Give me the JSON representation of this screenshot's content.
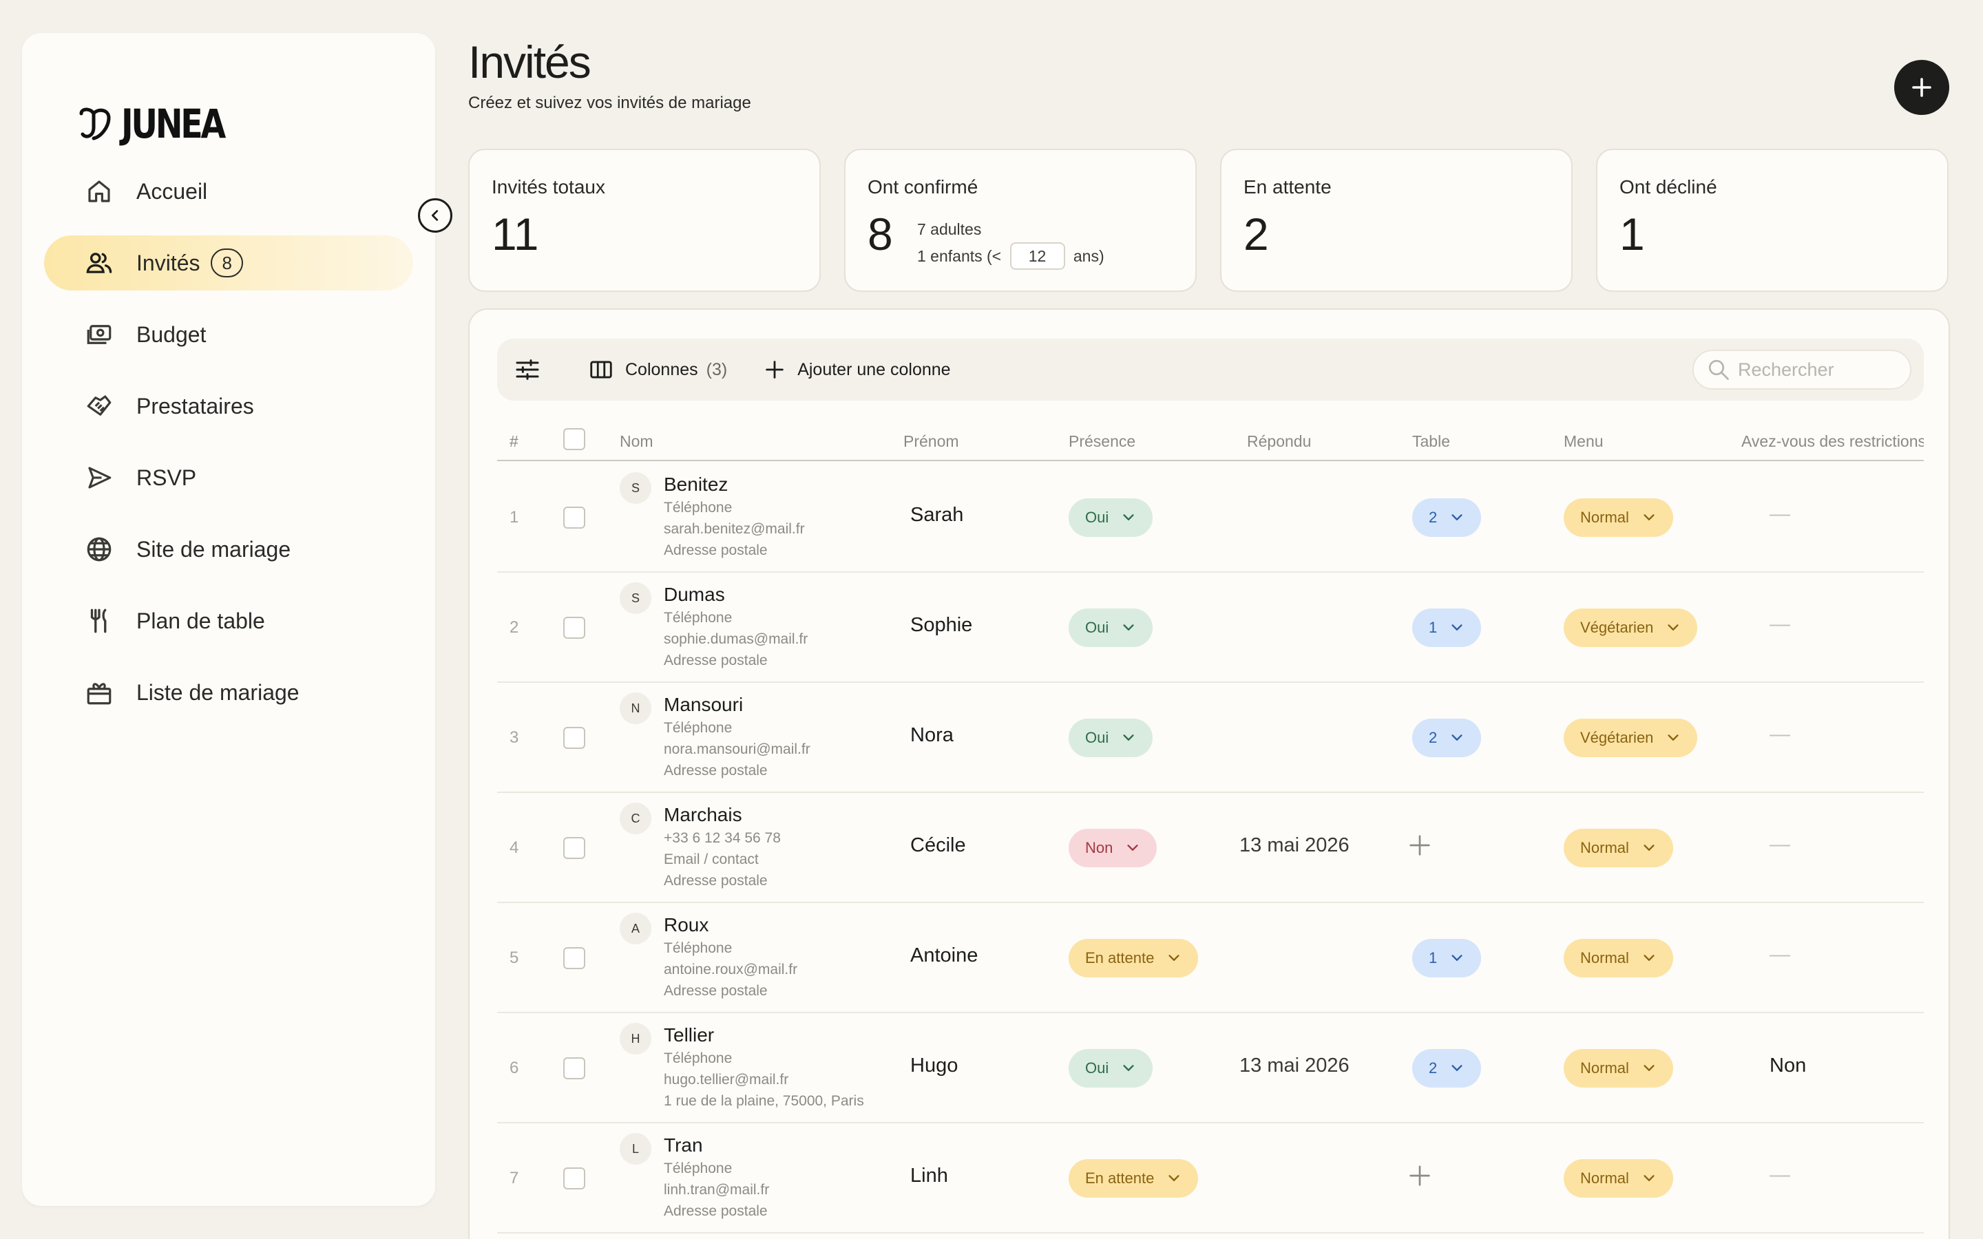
{
  "brand": {
    "name": "JUNEA"
  },
  "sidebar": {
    "items": [
      {
        "label": "Accueil",
        "icon": "home-icon"
      },
      {
        "label": "Invités",
        "icon": "users-icon",
        "badge": "8",
        "active": true
      },
      {
        "label": "Budget",
        "icon": "money-icon"
      },
      {
        "label": "Prestataires",
        "icon": "handshake-icon"
      },
      {
        "label": "RSVP",
        "icon": "send-icon"
      },
      {
        "label": "Site de mariage",
        "icon": "globe-icon"
      },
      {
        "label": "Plan de table",
        "icon": "cutlery-icon"
      },
      {
        "label": "Liste de mariage",
        "icon": "gift-icon"
      }
    ]
  },
  "header": {
    "title": "Invités",
    "subtitle": "Créez et suivez vos invités de mariage"
  },
  "stats": {
    "total": {
      "label": "Invités totaux",
      "value": "11"
    },
    "confirmed": {
      "label": "Ont confirmé",
      "value": "8",
      "adults": "7 adultes",
      "children_prefix": "1 enfants (<",
      "age_limit": "12",
      "children_suffix": "ans)"
    },
    "pending": {
      "label": "En attente",
      "value": "2"
    },
    "declined": {
      "label": "Ont décliné",
      "value": "1"
    }
  },
  "toolbar": {
    "columns_label": "Colonnes",
    "columns_count": "(3)",
    "add_column_label": "Ajouter une colonne",
    "search_placeholder": "Rechercher"
  },
  "table": {
    "headers": {
      "num": "#",
      "nom": "Nom",
      "prenom": "Prénom",
      "presence": "Présence",
      "repondu": "Répondu",
      "table": "Table",
      "menu": "Menu",
      "restrictions": "Avez-vous des restrictions"
    },
    "rows": [
      {
        "num": "1",
        "initial": "S",
        "nom": "Benitez",
        "l1": "Téléphone",
        "l2": "sarah.benitez@mail.fr",
        "l3": "Adresse postale",
        "prenom": "Sarah",
        "presence": "Oui",
        "presence_type": "oui",
        "repondu": "",
        "table": "2",
        "menu": "Normal",
        "restriction": "—"
      },
      {
        "num": "2",
        "initial": "S",
        "nom": "Dumas",
        "l1": "Téléphone",
        "l2": "sophie.dumas@mail.fr",
        "l3": "Adresse postale",
        "prenom": "Sophie",
        "presence": "Oui",
        "presence_type": "oui",
        "repondu": "",
        "table": "1",
        "menu": "Végétarien",
        "restriction": "—"
      },
      {
        "num": "3",
        "initial": "N",
        "nom": "Mansouri",
        "l1": "Téléphone",
        "l2": "nora.mansouri@mail.fr",
        "l3": "Adresse postale",
        "prenom": "Nora",
        "presence": "Oui",
        "presence_type": "oui",
        "repondu": "",
        "table": "2",
        "menu": "Végétarien",
        "restriction": "—"
      },
      {
        "num": "4",
        "initial": "C",
        "nom": "Marchais",
        "l1": "+33 6 12 34 56 78",
        "l2": "Email / contact",
        "l3": "Adresse postale",
        "prenom": "Cécile",
        "presence": "Non",
        "presence_type": "non",
        "repondu": "13 mai 2026",
        "table": "",
        "menu": "Normal",
        "restriction": "—"
      },
      {
        "num": "5",
        "initial": "A",
        "nom": "Roux",
        "l1": "Téléphone",
        "l2": "antoine.roux@mail.fr",
        "l3": "Adresse postale",
        "prenom": "Antoine",
        "presence": "En attente",
        "presence_type": "att",
        "repondu": "",
        "table": "1",
        "menu": "Normal",
        "restriction": "—"
      },
      {
        "num": "6",
        "initial": "H",
        "nom": "Tellier",
        "l1": "Téléphone",
        "l2": "hugo.tellier@mail.fr",
        "l3": "1 rue de la plaine, 75000, Paris",
        "prenom": "Hugo",
        "presence": "Oui",
        "presence_type": "oui",
        "repondu": "13 mai 2026",
        "table": "2",
        "menu": "Normal",
        "restriction": "Non"
      },
      {
        "num": "7",
        "initial": "L",
        "nom": "Tran",
        "l1": "Téléphone",
        "l2": "linh.tran@mail.fr",
        "l3": "Adresse postale",
        "prenom": "Linh",
        "presence": "En attente",
        "presence_type": "att",
        "repondu": "",
        "table": "",
        "menu": "Normal",
        "restriction": "—"
      }
    ]
  },
  "colors": {
    "background": "#f4f1eb",
    "card": "#fdfcf8",
    "active_nav": "#fce7a8",
    "oui": "#d9ecdf",
    "non": "#f8d7da",
    "attente": "#fce3a4",
    "table_pill": "#d4e4fb"
  }
}
